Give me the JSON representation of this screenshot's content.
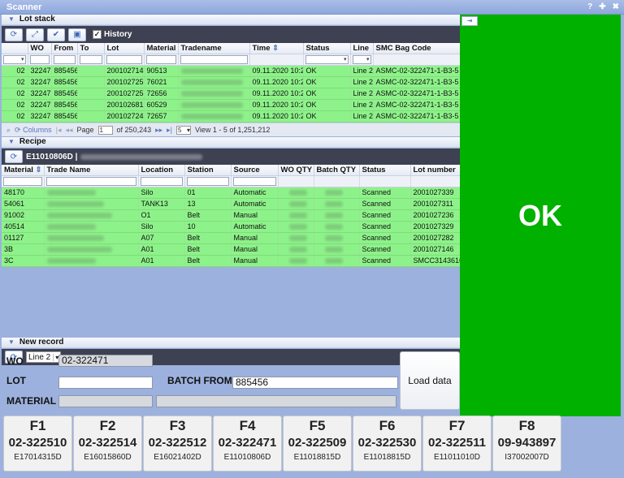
{
  "window": {
    "title": "Scanner",
    "icons": [
      "?",
      "✚",
      "✖"
    ]
  },
  "lot_stack": {
    "title": "Lot stack",
    "history_label": "History",
    "columns": [
      "",
      "WO",
      "From",
      "To",
      "Lot",
      "Material",
      "Tradename",
      "Time",
      "Status",
      "Line",
      "SMC Bag Code"
    ],
    "rows": [
      [
        "02",
        "322471",
        "885456",
        "",
        "2001027146",
        "90513",
        "",
        "09.11.2020 10:26",
        "OK",
        "Line 2",
        "ASMC-02-322471-1-B3-5"
      ],
      [
        "02",
        "322471",
        "885456",
        "",
        "2001027257",
        "76021",
        "",
        "09.11.2020 10:26",
        "OK",
        "Line 2",
        "ASMC-02-322471-1-B3-5"
      ],
      [
        "02",
        "322471",
        "885456",
        "",
        "2001027255",
        "72656",
        "",
        "09.11.2020 10:26",
        "OK",
        "Line 2",
        "ASMC-02-322471-1-B3-5"
      ],
      [
        "02",
        "322471",
        "885456",
        "",
        "2001026812",
        "60529",
        "",
        "09.11.2020 10:26",
        "OK",
        "Line 2",
        "ASMC-02-322471-1-B3-5"
      ],
      [
        "02",
        "322471",
        "885456",
        "",
        "2001027247",
        "72657",
        "",
        "09.11.2020 10:26",
        "OK",
        "Line 2",
        "ASMC-02-322471-1-B3-5"
      ]
    ],
    "pager": {
      "columns_label": "Columns",
      "page_label": "Page",
      "page_value": "1",
      "of_label": "of 250,243",
      "page_size": "5",
      "view_label": "View 1 - 5 of 1,251,212"
    }
  },
  "recipe": {
    "title": "Recipe",
    "batch_code": "E11010806D |",
    "columns": [
      "Material",
      "Trade Name",
      "Location",
      "Station",
      "Source",
      "WO QTY",
      "Batch QTY",
      "Status",
      "Lot number"
    ],
    "rows": [
      [
        "48170",
        "",
        "Silo",
        "01",
        "Automatic",
        "",
        "",
        "Scanned",
        "2001027339"
      ],
      [
        "54061",
        "",
        "TANK13",
        "13",
        "Automatic",
        "",
        "",
        "Scanned",
        "2001027311"
      ],
      [
        "91002",
        "",
        "O1",
        "Belt",
        "Manual",
        "",
        "",
        "Scanned",
        "2001027236"
      ],
      [
        "40514",
        "",
        "Silo",
        "10",
        "Automatic",
        "",
        "",
        "Scanned",
        "2001027329"
      ],
      [
        "01127",
        "",
        "A07",
        "Belt",
        "Manual",
        "",
        "",
        "Scanned",
        "2001027282"
      ],
      [
        "3B",
        "",
        "A01",
        "Belt",
        "Manual",
        "",
        "",
        "Scanned",
        "2001027146"
      ],
      [
        "3C",
        "",
        "A01",
        "Belt",
        "Manual",
        "",
        "",
        "Scanned",
        "SMCC3143616"
      ]
    ]
  },
  "new_record": {
    "title": "New record",
    "line_select": "Line 2",
    "wo_label": "WO",
    "wo_value": "02-322471",
    "lot_label": "LOT",
    "lot_value": "",
    "batch_from_label": "BATCH FROM",
    "batch_from_value": "885456",
    "material_label": "MATERIAL",
    "load_button": "Load data"
  },
  "status_panel": {
    "text": "OK",
    "color": "#00b100"
  },
  "fkeys": [
    {
      "key": "F1",
      "wo": "02-322510",
      "code": "E17014315D"
    },
    {
      "key": "F2",
      "wo": "02-322514",
      "code": "E16015860D"
    },
    {
      "key": "F3",
      "wo": "02-322512",
      "code": "E16021402D"
    },
    {
      "key": "F4",
      "wo": "02-322471",
      "code": "E11010806D"
    },
    {
      "key": "F5",
      "wo": "02-322509",
      "code": "E11018815D"
    },
    {
      "key": "F6",
      "wo": "02-322530",
      "code": "E11018815D"
    },
    {
      "key": "F7",
      "wo": "02-322511",
      "code": "E11011010D"
    },
    {
      "key": "F8",
      "wo": "09-943897",
      "code": "I37002007D"
    }
  ]
}
